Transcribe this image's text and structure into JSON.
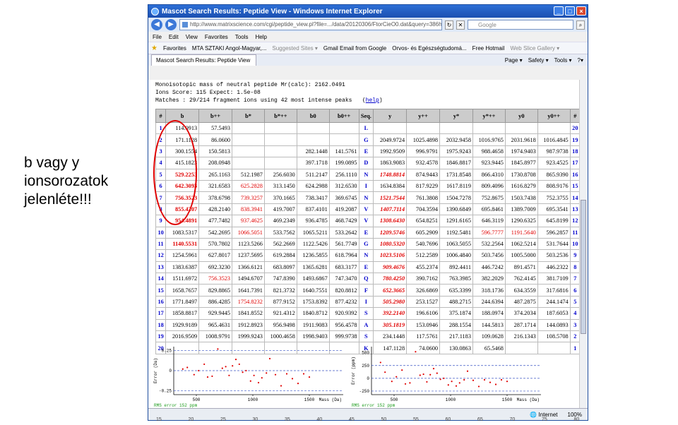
{
  "slide_note": "b vagy y ionsorozatok jelenléte!!!",
  "window": {
    "title": "Mascot Search Results: Peptide View - Windows Internet Explorer",
    "controls": [
      "_",
      "□",
      "×"
    ]
  },
  "addressbar": {
    "url": "http://www.matrixscience.com/cgi/peptide_view.pl?file=.../data/20120306/FtorCieO0.dat&query=386hit",
    "search_placeholder": "Google"
  },
  "menu": [
    "File",
    "Edit",
    "View",
    "Favorites",
    "Tools",
    "Help"
  ],
  "favorites": {
    "label": "Favorites",
    "items": [
      "MTA SZTAKI Angol-Magyar,...",
      "Suggested Sites ▾",
      "Gmail Email from Google",
      "Orvos- és Egészségtudomá...",
      "Free Hotmail",
      "Web Slice Gallery ▾"
    ]
  },
  "tab": {
    "label": "Mascot Search Results: Peptide View",
    "commands": [
      "Page ▾",
      "Safety ▾",
      "Tools ▾",
      "?▾"
    ]
  },
  "info": {
    "line1": "Monoisotopic mass of neutral peptide Mr(calc): 2162.0491",
    "line2": "Ions Score: 115  Expect: 1.5e-08",
    "line3": "Matches : 29/214 fragment ions using 42 most intense peaks",
    "help": "help"
  },
  "table": {
    "headers": [
      "#",
      "b",
      "b++",
      "b*",
      "b*++",
      "b0",
      "b0++",
      "Seq.",
      "y",
      "y++",
      "y*",
      "y*++",
      "y0",
      "y0++",
      "#"
    ],
    "rows": [
      [
        "1",
        "114.0913",
        "57.5493",
        "",
        "",
        "",
        "",
        "L",
        "",
        "",
        "",
        "",
        "",
        "",
        "20"
      ],
      [
        "2",
        "171.1128",
        "86.0600",
        "",
        "",
        "",
        "",
        "G",
        "2049.9724",
        "1025.4898",
        "2032.9458",
        "1016.9765",
        "2031.9618",
        "1016.4845",
        "19"
      ],
      [
        "3",
        "300.1554",
        "150.5813",
        "",
        "",
        "282.1448",
        "141.5761",
        "E",
        "1992.9509",
        "996.9791",
        "1975.9243",
        "988.4658",
        "1974.9403",
        "987.9738",
        "18"
      ],
      [
        "4",
        "415.1823",
        "208.0948",
        "",
        "",
        "397.1718",
        "199.0895",
        "D",
        "1863.9083",
        "932.4578",
        "1846.8817",
        "923.9445",
        "1845.8977",
        "923.4525",
        "17"
      ],
      [
        "5",
        "529.2253",
        "265.1163",
        "512.1987",
        "256.6030",
        "511.2147",
        "256.1110",
        "N",
        "1748.8814",
        "874.9443",
        "1731.8548",
        "866.4310",
        "1730.8708",
        "865.9390",
        "16"
      ],
      [
        "6",
        "642.3093",
        "321.6583",
        "625.2828",
        "313.1450",
        "624.2988",
        "312.6530",
        "I",
        "1634.8384",
        "817.9229",
        "1617.8119",
        "809.4096",
        "1616.8279",
        "808.9176",
        "15"
      ],
      [
        "7",
        "756.3523",
        "378.6798",
        "739.3257",
        "370.1665",
        "738.3417",
        "369.6745",
        "N",
        "1521.7544",
        "761.3808",
        "1504.7278",
        "752.8675",
        "1503.7438",
        "752.3755",
        "14"
      ],
      [
        "8",
        "855.4207",
        "428.2140",
        "838.3941",
        "419.7007",
        "837.4101",
        "419.2087",
        "V",
        "1407.7114",
        "704.3594",
        "1390.6849",
        "695.8461",
        "1389.7009",
        "695.3541",
        "13"
      ],
      [
        "9",
        "954.4891",
        "477.7482",
        "937.4625",
        "469.2349",
        "936.4785",
        "468.7429",
        "V",
        "1308.6430",
        "654.8251",
        "1291.6165",
        "646.3119",
        "1290.6325",
        "645.8199",
        "12"
      ],
      [
        "10",
        "1083.5317",
        "542.2695",
        "1066.5051",
        "533.7562",
        "1065.5211",
        "533.2642",
        "E",
        "1209.5746",
        "605.2909",
        "1192.5481",
        "596.7777",
        "1191.5640",
        "596.2857",
        "11"
      ],
      [
        "11",
        "1140.5531",
        "570.7802",
        "1123.5266",
        "562.2669",
        "1122.5426",
        "561.7749",
        "G",
        "1080.5320",
        "540.7696",
        "1063.5055",
        "532.2564",
        "1062.5214",
        "531.7644",
        "10"
      ],
      [
        "12",
        "1254.5961",
        "627.8017",
        "1237.5695",
        "619.2884",
        "1236.5855",
        "618.7964",
        "N",
        "1023.5106",
        "512.2589",
        "1006.4840",
        "503.7456",
        "1005.5000",
        "503.2536",
        "9"
      ],
      [
        "13",
        "1383.6387",
        "692.3230",
        "1366.6121",
        "683.8097",
        "1365.6281",
        "683.3177",
        "E",
        "909.4676",
        "455.2374",
        "892.4411",
        "446.7242",
        "891.4571",
        "446.2322",
        "8"
      ],
      [
        "14",
        "1511.6972",
        "756.3523",
        "1494.6707",
        "747.8390",
        "1493.6867",
        "747.3470",
        "Q",
        "780.4250",
        "390.7162",
        "763.3985",
        "382.2029",
        "762.4145",
        "381.7109",
        "7"
      ],
      [
        "15",
        "1658.7657",
        "829.8865",
        "1641.7391",
        "821.3732",
        "1640.7551",
        "820.8812",
        "F",
        "652.3665",
        "326.6869",
        "635.3399",
        "318.1736",
        "634.3559",
        "317.6816",
        "6"
      ],
      [
        "16",
        "1771.8497",
        "886.4285",
        "1754.8232",
        "877.9152",
        "1753.8392",
        "877.4232",
        "I",
        "505.2980",
        "253.1527",
        "488.2715",
        "244.6394",
        "487.2875",
        "244.1474",
        "5"
      ],
      [
        "17",
        "1858.8817",
        "929.9445",
        "1841.8552",
        "921.4312",
        "1840.8712",
        "920.9392",
        "S",
        "392.2140",
        "196.6106",
        "375.1874",
        "188.0974",
        "374.2034",
        "187.6053",
        "4"
      ],
      [
        "18",
        "1929.9189",
        "965.4631",
        "1912.8923",
        "956.9498",
        "1911.9083",
        "956.4578",
        "A",
        "305.1819",
        "153.0946",
        "288.1554",
        "144.5813",
        "287.1714",
        "144.0893",
        "3"
      ],
      [
        "19",
        "2016.9509",
        "1008.9791",
        "1999.9243",
        "1000.4658",
        "1998.9403",
        "999.9738",
        "S",
        "234.1448",
        "117.5761",
        "217.1183",
        "109.0628",
        "216.1343",
        "108.5708",
        "2"
      ],
      [
        "20",
        "",
        "",
        "",
        "",
        "",
        "",
        "K",
        "147.1128",
        "74.0600",
        "130.0863",
        "65.5468",
        "",
        "",
        "1"
      ]
    ]
  },
  "plot_left": {
    "ylabel": "Error (Da)",
    "xlabel": "Mass (Da)",
    "yticks": [
      "0.25",
      "0",
      "-0.25"
    ],
    "xticks": [
      "500",
      "1000",
      "1500"
    ],
    "rms": "RMS error 152 ppm",
    "points": [
      [
        380,
        0.02
      ],
      [
        420,
        0.04
      ],
      [
        480,
        -0.05
      ],
      [
        520,
        0.0
      ],
      [
        570,
        0.08
      ],
      [
        600,
        -0.08
      ],
      [
        640,
        -0.07
      ],
      [
        690,
        0.27
      ],
      [
        730,
        0.03
      ],
      [
        760,
        0.05
      ],
      [
        790,
        -0.06
      ],
      [
        820,
        0.06
      ],
      [
        850,
        0.14
      ],
      [
        880,
        0.08
      ],
      [
        910,
        -0.02
      ],
      [
        940,
        0.0
      ],
      [
        980,
        -0.13
      ],
      [
        1010,
        -0.06
      ],
      [
        1050,
        -0.15
      ],
      [
        1080,
        -0.09
      ],
      [
        1120,
        -0.03
      ],
      [
        1150,
        0.15
      ],
      [
        1200,
        -0.05
      ],
      [
        1250,
        -0.19
      ],
      [
        1300,
        -0.04
      ],
      [
        1350,
        -0.1
      ],
      [
        1400,
        -0.16
      ],
      [
        1450,
        -0.04
      ],
      [
        1500,
        -0.08
      ]
    ]
  },
  "plot_right": {
    "ylabel": "Error (ppm)",
    "xlabel": "Mass (Da)",
    "yticks": [
      "500",
      "250",
      "0",
      "-250"
    ],
    "xticks": [
      "500",
      "1000",
      "1500"
    ],
    "rms": "RMS error 152 ppm",
    "points": [
      [
        380,
        310
      ],
      [
        420,
        120
      ],
      [
        480,
        -60
      ],
      [
        520,
        30
      ],
      [
        570,
        160
      ],
      [
        600,
        -110
      ],
      [
        640,
        -90
      ],
      [
        690,
        520
      ],
      [
        730,
        60
      ],
      [
        760,
        80
      ],
      [
        790,
        -70
      ],
      [
        820,
        70
      ],
      [
        850,
        190
      ],
      [
        880,
        100
      ],
      [
        910,
        -20
      ],
      [
        940,
        0
      ],
      [
        980,
        -130
      ],
      [
        1010,
        -60
      ],
      [
        1050,
        -150
      ],
      [
        1080,
        -90
      ],
      [
        1120,
        -30
      ],
      [
        1150,
        140
      ],
      [
        1200,
        -40
      ],
      [
        1250,
        -160
      ],
      [
        1300,
        -30
      ],
      [
        1350,
        -80
      ],
      [
        1400,
        -120
      ],
      [
        1450,
        -30
      ],
      [
        1500,
        -60
      ]
    ]
  },
  "status": {
    "zone": "Internet",
    "zoom": "100%"
  },
  "ruler": [
    "15",
    "20",
    "25",
    "30",
    "35",
    "40",
    "45",
    "50",
    "55",
    "60",
    "65",
    "70",
    "75",
    "80"
  ]
}
